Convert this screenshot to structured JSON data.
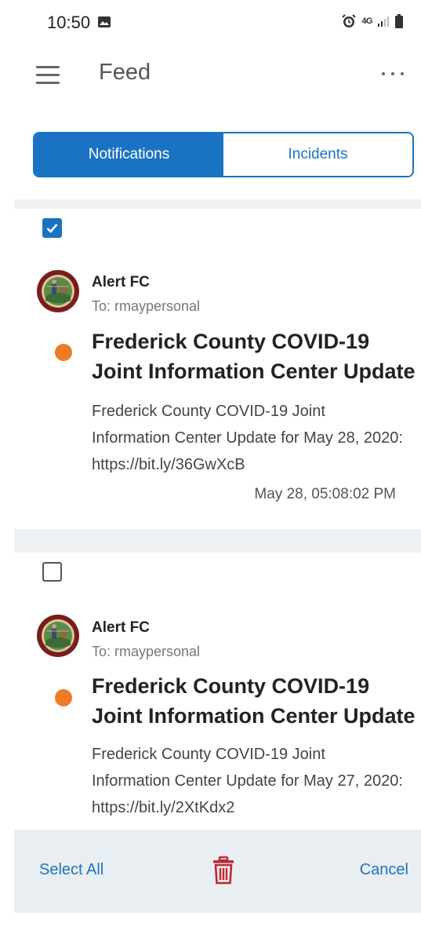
{
  "status_bar": {
    "time": "10:50",
    "network": "4G"
  },
  "app_bar": {
    "title": "Feed"
  },
  "tabs": [
    {
      "label": "Notifications",
      "active": true
    },
    {
      "label": "Incidents",
      "active": false
    }
  ],
  "feed": [
    {
      "checked": true,
      "sender": "Alert FC",
      "recipient": "To: rmaypersonal",
      "unread": true,
      "title": "Frederick County COVID-19 Joint Information Center Update",
      "body": "Frederick County COVID-19 Joint Information Center Update for May 28, 2020: https://bit.ly/36GwXcB",
      "timestamp": "May 28, 05:08:02 PM"
    },
    {
      "checked": false,
      "sender": "Alert FC",
      "recipient": "To: rmaypersonal",
      "unread": true,
      "title": "Frederick County COVID-19 Joint Information Center Update",
      "body": "Frederick County COVID-19 Joint Information Center Update for May 27, 2020: https://bit.ly/2XtKdx2"
    }
  ],
  "action_bar": {
    "select_all": "Select All",
    "cancel": "Cancel",
    "delete_icon": "trash-icon"
  },
  "colors": {
    "accent": "#1a73c2",
    "unread_dot": "#f07a26",
    "delete": "#c0272d"
  }
}
